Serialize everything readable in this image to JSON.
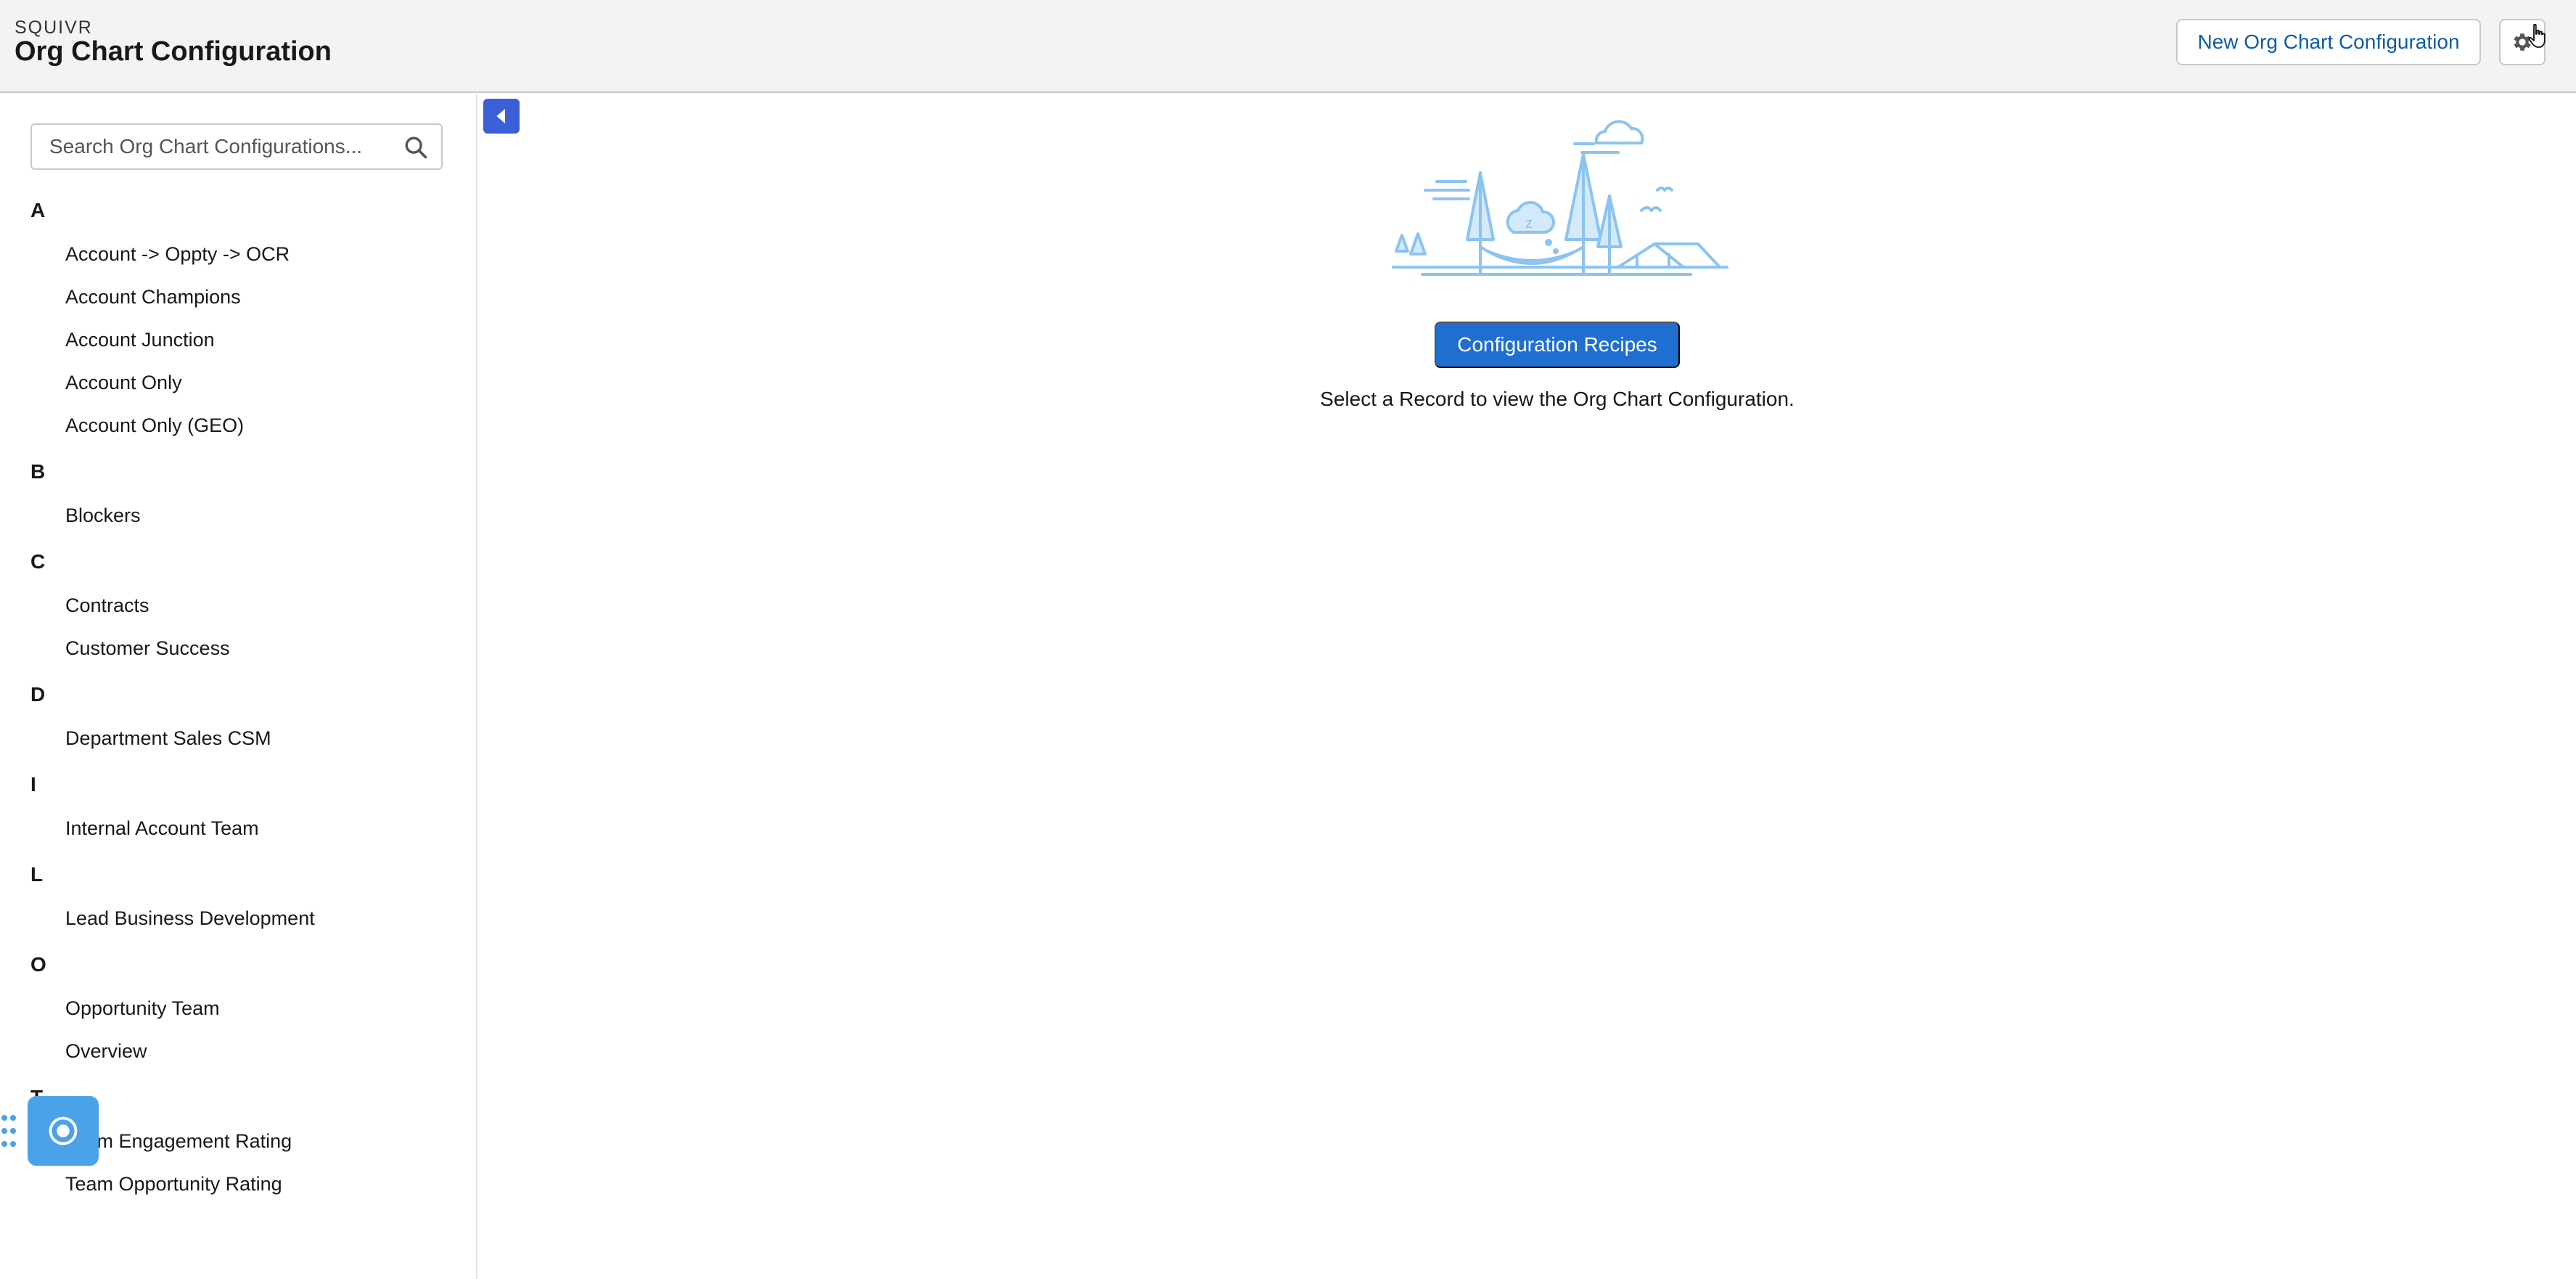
{
  "header": {
    "brand": "SQUIVR",
    "title": "Org Chart Configuration",
    "new_button_label": "New Org Chart Configuration"
  },
  "sidebar": {
    "search_placeholder": "Search Org Chart Configurations...",
    "groups": [
      {
        "letter": "A",
        "items": [
          "Account -> Oppty -> OCR",
          "Account Champions",
          "Account Junction",
          "Account Only",
          "Account Only (GEO)"
        ]
      },
      {
        "letter": "B",
        "items": [
          "Blockers"
        ]
      },
      {
        "letter": "C",
        "items": [
          "Contracts",
          "Customer Success"
        ]
      },
      {
        "letter": "D",
        "items": [
          "Department Sales CSM"
        ]
      },
      {
        "letter": "I",
        "items": [
          "Internal Account Team"
        ]
      },
      {
        "letter": "L",
        "items": [
          "Lead Business Development"
        ]
      },
      {
        "letter": "O",
        "items": [
          "Opportunity Team",
          "Overview"
        ]
      },
      {
        "letter": "T",
        "items": [
          "Team Engagement Rating",
          "Team Opportunity Rating"
        ]
      }
    ]
  },
  "main": {
    "recipes_button_label": "Configuration Recipes",
    "empty_message": "Select a Record to view the Org Chart Configuration."
  },
  "icons": {
    "search": "search-icon",
    "gear": "gear-icon",
    "collapse": "chevron-left-icon",
    "float": "target-icon",
    "drag": "drag-handle-icon"
  },
  "colors": {
    "accent": "#1f6fd0",
    "link": "#0b5cab",
    "toggle": "#3a5fd9",
    "float_button": "#4aa3e8",
    "illustration": "#8cc3ef"
  }
}
